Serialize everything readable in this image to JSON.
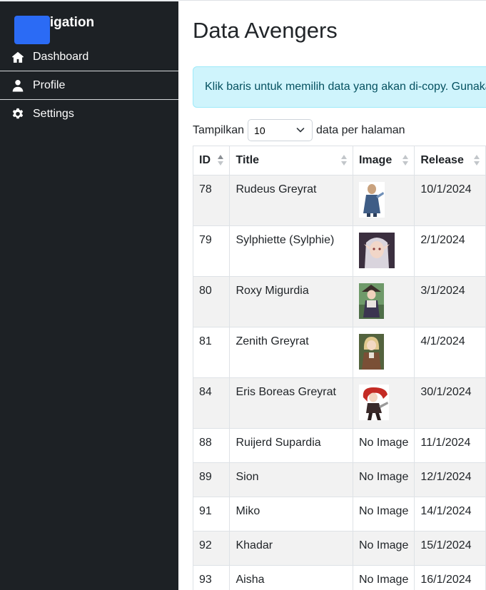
{
  "sidebar": {
    "brand": "Navigation",
    "items": [
      {
        "label": "Dashboard",
        "icon": "home-icon"
      },
      {
        "label": "Profile",
        "icon": "user-icon"
      },
      {
        "label": "Settings",
        "icon": "gear-icon"
      }
    ]
  },
  "main": {
    "title": "Data Avengers",
    "alert": "Klik baris untuk memilih data yang akan di-copy. Gunakan",
    "length": {
      "prefix": "Tampilkan",
      "value": "10",
      "suffix": "data per halaman"
    },
    "table": {
      "headers": [
        "ID",
        "Title",
        "Image",
        "Release"
      ],
      "rows": [
        {
          "id": "78",
          "title": "Rudeus Greyrat",
          "image": "",
          "release": "10/1/2024"
        },
        {
          "id": "79",
          "title": "Sylphiette (Sylphie)",
          "image": "",
          "release": "2/1/2024"
        },
        {
          "id": "80",
          "title": "Roxy Migurdia",
          "image": "",
          "release": "3/1/2024"
        },
        {
          "id": "81",
          "title": "Zenith Greyrat",
          "image": "",
          "release": "4/1/2024"
        },
        {
          "id": "84",
          "title": "Eris Boreas Greyrat",
          "image": "",
          "release": "30/1/2024"
        },
        {
          "id": "88",
          "title": "Ruijerd Supardia",
          "image": "No Image",
          "release": "11/1/2024"
        },
        {
          "id": "89",
          "title": "Sion",
          "image": "No Image",
          "release": "12/1/2024"
        },
        {
          "id": "91",
          "title": "Miko",
          "image": "No Image",
          "release": "14/1/2024"
        },
        {
          "id": "92",
          "title": "Khadar",
          "image": "No Image",
          "release": "15/1/2024"
        },
        {
          "id": "93",
          "title": "Aisha",
          "image": "No Image",
          "release": "16/1/2024"
        }
      ]
    }
  },
  "colors": {
    "sidebar_bg": "#1d2125",
    "brand_logo": "#2b6bf5",
    "alert_bg": "#cff4fc",
    "alert_text": "#055160"
  }
}
